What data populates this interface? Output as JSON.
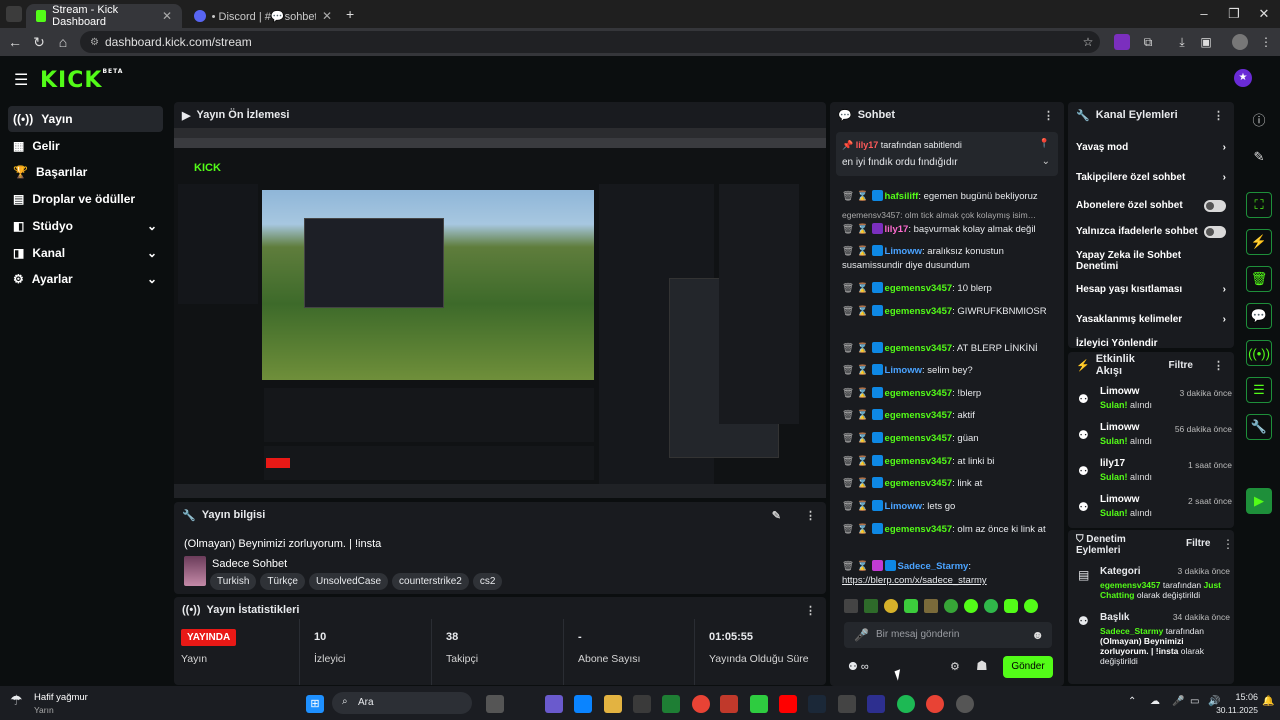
{
  "browser": {
    "tabs": [
      {
        "title": "Stream - Kick Dashboard"
      },
      {
        "title": "• Discord | #💬sohbet | HUGO…"
      }
    ],
    "url": "dashboard.kick.com/stream"
  },
  "header": {
    "logo": "KICK",
    "logo_sup": "BETA"
  },
  "sidebar": {
    "items": [
      {
        "label": "Yayın",
        "icon": "broadcast-icon"
      },
      {
        "label": "Gelir",
        "icon": "revenue-icon"
      },
      {
        "label": "Başarılar",
        "icon": "trophy-icon"
      },
      {
        "label": "Droplar ve ödüller",
        "icon": "gift-icon"
      },
      {
        "label": "Stüdyo",
        "icon": "studio-icon"
      },
      {
        "label": "Kanal",
        "icon": "channel-icon"
      },
      {
        "label": "Ayarlar",
        "icon": "gear-icon"
      }
    ]
  },
  "preview": {
    "title": "Yayın Ön İzlemesi"
  },
  "stream_info": {
    "title": "Yayın bilgisi",
    "stream_title": "(Olmayan) Beynimizi zorluyorum. | !insta",
    "category": "Sadece Sohbet",
    "tags": [
      "Turkish",
      "Türkçe",
      "UnsolvedCase",
      "counterstrike2",
      "cs2"
    ]
  },
  "stats": {
    "title": "Yayın İstatistikleri",
    "live_badge": "YAYINDA",
    "items": [
      {
        "value": "",
        "label": "Yayın"
      },
      {
        "value": "10",
        "label": "İzleyici"
      },
      {
        "value": "38",
        "label": "Takipçi"
      },
      {
        "value": "-",
        "label": "Abone Sayısı"
      },
      {
        "value": "01:05:55",
        "label": "Yayında Olduğu Süre"
      }
    ]
  },
  "chat": {
    "title": "Sohbet",
    "pinned_user": "lily17",
    "pinned_by": "tarafından sabitlendi",
    "pinned_text": "en iyi fındık ordu fındığıdır",
    "reply_hint": "egemensv3457: olm tick almak çok kolaymış isim…",
    "messages": [
      {
        "user": "hafsiliff",
        "text": "egemen bugünü bekliyoruz",
        "cls": "u"
      },
      {
        "user": "lily17",
        "text": "başvurmak kolay almak değil",
        "cls": "u p"
      },
      {
        "user": "Limoww",
        "text": "aralıksız konustun susamissundir diye dusundum",
        "cls": "u b"
      },
      {
        "user": "egemensv3457",
        "text": "10 blerp",
        "cls": "u"
      },
      {
        "user": "egemensv3457",
        "text": "GIWRUFKBNMIOSR",
        "cls": "u"
      },
      {
        "user": "egemensv3457",
        "text": "AT BLERP LİNKİNİ",
        "cls": "u"
      },
      {
        "user": "Limoww",
        "text": "selim bey?",
        "cls": "u b"
      },
      {
        "user": "egemensv3457",
        "text": "!blerp",
        "cls": "u"
      },
      {
        "user": "egemensv3457",
        "text": "aktif",
        "cls": "u"
      },
      {
        "user": "egemensv3457",
        "text": "güan",
        "cls": "u"
      },
      {
        "user": "egemensv3457",
        "text": "at linki bi",
        "cls": "u"
      },
      {
        "user": "egemensv3457",
        "text": "link at",
        "cls": "u"
      },
      {
        "user": "Limoww",
        "text": "lets go",
        "cls": "u b"
      },
      {
        "user": "egemensv3457",
        "text": "olm az önce ki link at",
        "cls": "u"
      },
      {
        "user": "Sadece_Starmy",
        "text": "https://blerp.com/x/sadece_starmy",
        "cls": "u b"
      }
    ],
    "input_placeholder": "Bir mesaj gönderin",
    "send_label": "Gönder"
  },
  "channel_actions": {
    "title": "Kanal Eylemleri",
    "items": [
      {
        "label": "Yavaş mod",
        "kind": "arrow"
      },
      {
        "label": "Takipçilere özel sohbet",
        "kind": "arrow"
      },
      {
        "label": "Abonelere özel sohbet",
        "kind": "toggle"
      },
      {
        "label": "Yalnızca ifadelerle sohbet",
        "kind": "toggle"
      },
      {
        "label": "Yapay Zeka ile Sohbet Denetimi",
        "kind": "external"
      },
      {
        "label": "Hesap yaşı kısıtlaması",
        "kind": "arrow"
      },
      {
        "label": "Yasaklanmış kelimeler",
        "kind": "arrow"
      },
      {
        "label": "İzleyici Yönlendir",
        "kind": "none"
      }
    ]
  },
  "activity": {
    "title": "Etkinlik Akışı",
    "filter": "Filtre",
    "events": [
      {
        "user": "Limoww",
        "action_hl": "Sulan!",
        "action": "alındı",
        "time": "3 dakika önce"
      },
      {
        "user": "Limoww",
        "action_hl": "Sulan!",
        "action": "alındı",
        "time": "56 dakika önce"
      },
      {
        "user": "lily17",
        "action_hl": "Sulan!",
        "action": "alındı",
        "time": "1 saat önce"
      },
      {
        "user": "Limoww",
        "action_hl": "Sulan!",
        "action": "alındı",
        "time": "2 saat önce"
      }
    ]
  },
  "moderation": {
    "title": "Denetim Eylemleri",
    "filter": "Filtre",
    "items": [
      {
        "kind": "Kategori",
        "time": "3 dakika önce",
        "actor": "egemensv3457",
        "by": "tarafından",
        "target": "Just Chatting",
        "rest": "olarak değiştirildi"
      },
      {
        "kind": "Başlık",
        "time": "34 dakika önce",
        "actor": "Sadece_Starmy",
        "by": "tarafından",
        "target": "(Olmayan) Beynimizi zorluyorum. | !insta",
        "rest": "olarak değiştirildi"
      }
    ]
  },
  "taskbar": {
    "weather_title": "Hafif yağmur",
    "weather_sub": "Yarın",
    "search": "Ara",
    "time": "15:06",
    "date": "30.11.2025"
  },
  "colors": {
    "accent": "#53fc18",
    "live": "#e91916",
    "panel": "#191b1f",
    "bg": "#0b0e0f"
  }
}
